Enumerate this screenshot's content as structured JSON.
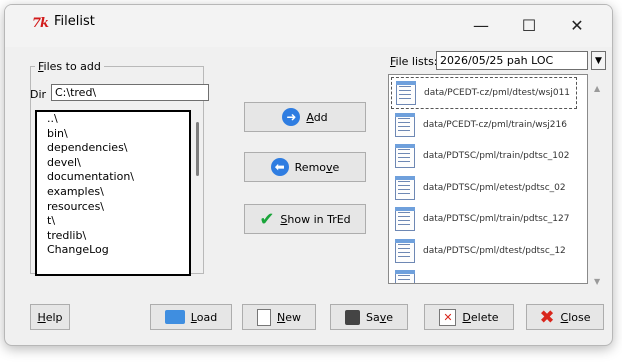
{
  "window": {
    "app_icon_text": "7k",
    "title": "Filelist",
    "controls": {
      "minimize": "—",
      "maximize": "☐",
      "close": "✕"
    }
  },
  "files_to_add": {
    "legend_key": "F",
    "legend_rest": "iles to add",
    "dir_label": "Dir",
    "dir_value": "C:\\tred\\",
    "entries": [
      "..\\",
      "bin\\",
      "dependencies\\",
      "devel\\",
      "documentation\\",
      "examples\\",
      "resources\\",
      "t\\",
      "tredlib\\",
      "ChangeLog"
    ]
  },
  "actions": {
    "add": {
      "key": "A",
      "rest": "dd"
    },
    "remove": {
      "pre": "Remo",
      "key": "v",
      "rest": "e"
    },
    "show": {
      "key": "S",
      "rest": "how in TrEd"
    }
  },
  "file_lists": {
    "label_key": "F",
    "label_rest": "ile lists:",
    "selected": "2026/05/25 pah LOC",
    "items": [
      "data/PCEDT-cz/pml/dtest/wsj011",
      "data/PCEDT-cz/pml/train/wsj216",
      "data/PDTSC/pml/train/pdtsc_102",
      "data/PDTSC/pml/etest/pdtsc_02",
      "data/PDTSC/pml/train/pdtsc_127",
      "data/PDTSC/pml/dtest/pdtsc_12"
    ]
  },
  "bottom": {
    "help": {
      "key": "H",
      "rest": "elp"
    },
    "load": {
      "key": "L",
      "rest": "oad"
    },
    "new": {
      "key": "N",
      "rest": "ew"
    },
    "save": {
      "pre": "Sa",
      "key": "v",
      "rest": "e"
    },
    "delete": {
      "key": "D",
      "rest": "elete"
    },
    "close": {
      "key": "C",
      "rest": "lose"
    }
  },
  "colors": {
    "accent": "#2f7de1",
    "app_icon": "#d21a1a",
    "check": "#1aa53a",
    "close_x": "#d9261c"
  }
}
